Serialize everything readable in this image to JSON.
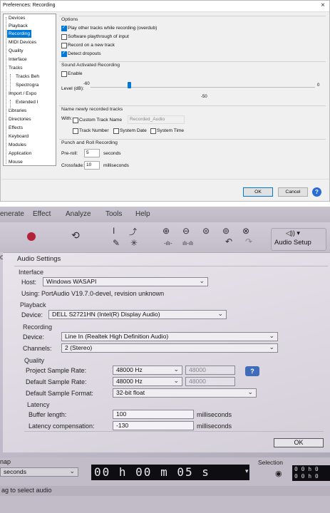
{
  "dialog": {
    "title": "Preferences: Recording",
    "close_glyph": "×",
    "tree": [
      "Devices",
      "Playback",
      "Recording",
      "MIDI Devices",
      "Quality",
      "Interface",
      "Tracks",
      "Tracks Beh",
      "Spectrogra",
      "Import / Expo",
      "Extended I",
      "Libraries",
      "Directories",
      "Effects",
      "Keyboard",
      "Modules",
      "Application",
      "Mouse"
    ],
    "options": {
      "heading": "Options",
      "items": [
        {
          "label": "Play other tracks while recording (overdub)",
          "checked": true
        },
        {
          "label": "Software playthrough of input",
          "checked": false
        },
        {
          "label": "Record on a new track",
          "checked": false
        },
        {
          "label": "Detect dropouts",
          "checked": true
        }
      ]
    },
    "sound_activated": {
      "heading": "Sound Activated Recording",
      "enable_label": "Enable",
      "enable_checked": false,
      "level_label": "Level (dB):",
      "min": "-60",
      "max": "0",
      "value_label": "-50",
      "value_fraction": 0.17
    },
    "naming": {
      "heading": "Name newly recorded tracks",
      "with_label": "With:",
      "custom_label": "Custom Track Name",
      "custom_value": "Recorded_Audio",
      "track_number": "Track Number",
      "system_date": "System Date",
      "system_time": "System Time"
    },
    "punch": {
      "heading": "Punch and Roll Recording",
      "preroll_label": "Pre-roll:",
      "preroll_value": "5",
      "preroll_unit": "seconds",
      "crossfade_label": "Crossfade:",
      "crossfade_value": "10",
      "crossfade_unit": "milliseconds"
    },
    "buttons": {
      "ok": "OK",
      "cancel": "Cancel",
      "help": "?"
    }
  },
  "photo": {
    "menu": [
      "enerate",
      "Effect",
      "Analyze",
      "Tools",
      "Help"
    ],
    "audio_setup_label": "Audio Setup",
    "audio_setup_icon_text": "◁)) ▾",
    "left_edge_char": "o",
    "audio_settings": {
      "title": "Audio Settings",
      "interface_heading": "Interface",
      "host_label": "Host:",
      "host_value": "Windows WASAPI",
      "using_text": "Using: PortAudio V19.7.0-devel, revision unknown",
      "playback_heading": "Playback",
      "playback_device_label": "Device:",
      "playback_device_value": "DELL S2721HN (Intel(R) Display Audio)",
      "recording_heading": "Recording",
      "recording_device_label": "Device:",
      "recording_device_value": "Line In (Realtek High Definition Audio)",
      "channels_label": "Channels:",
      "channels_value": "2 (Stereo)",
      "quality_heading": "Quality",
      "project_rate_label": "Project Sample Rate:",
      "project_rate_value": "48000 Hz",
      "project_rate_field": "48000",
      "default_rate_label": "Default Sample Rate:",
      "default_rate_value": "48000 Hz",
      "default_rate_field": "48000",
      "default_format_label": "Default Sample Format:",
      "default_format_value": "32-bit float",
      "latency_heading": "Latency",
      "buffer_label": "Buffer length:",
      "buffer_value": "100",
      "buffer_unit": "milliseconds",
      "comp_label": "Latency compensation:",
      "comp_value": "-130",
      "comp_unit": "milliseconds",
      "help": "?",
      "ok": "OK"
    },
    "status": {
      "snap_label": "nap",
      "snap_value": "seconds",
      "time_value": "00 h 00 m 05 s",
      "selection_label": "Selection",
      "sel_line1": "0 0 h 0",
      "sel_line2": "0 0 h 0",
      "hint": "ag to select audio"
    }
  }
}
